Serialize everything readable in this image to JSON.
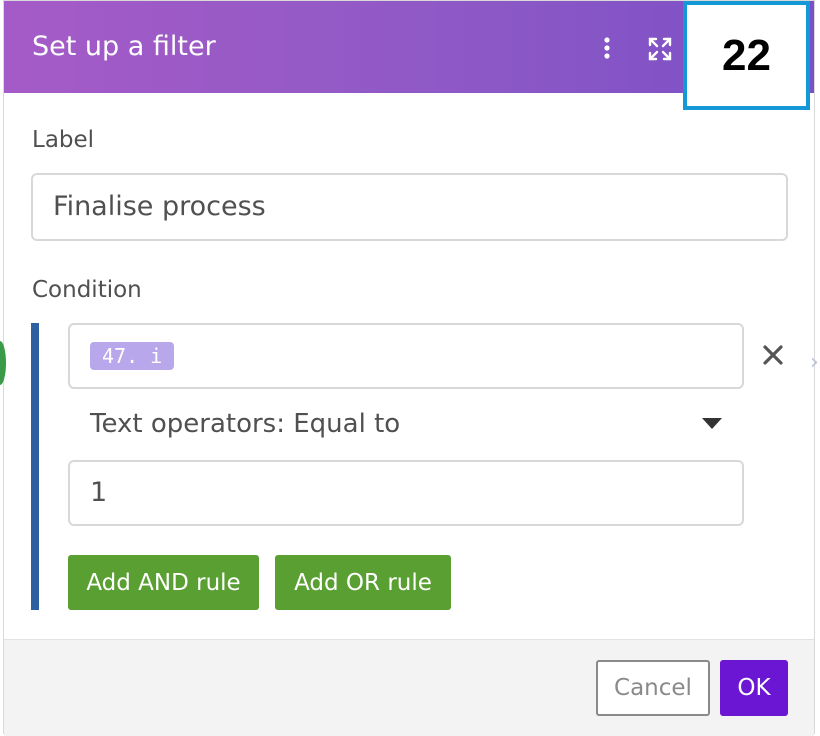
{
  "header": {
    "title": "Set up a filter",
    "menu_icon": "more-vertical-icon",
    "expand_icon": "expand-icon",
    "gradient_start": "#a55bc7",
    "gradient_end": "#7b4fc6"
  },
  "step_badge": {
    "number": "22",
    "border_color": "#1499d6"
  },
  "label_section": {
    "label": "Label",
    "input_value": "Finalise process"
  },
  "condition_section": {
    "label": "Condition",
    "bar_color": "#2e5fa0",
    "operand_token": "47. i",
    "operator": "Text operators: Equal to",
    "comparison_value": "1",
    "remove_icon": "close-icon",
    "add_and_label": "Add AND rule",
    "add_or_label": "Add OR rule",
    "rule_button_color": "#5a9f32"
  },
  "footer": {
    "cancel_label": "Cancel",
    "ok_label": "OK",
    "ok_color": "#6a16d3"
  }
}
